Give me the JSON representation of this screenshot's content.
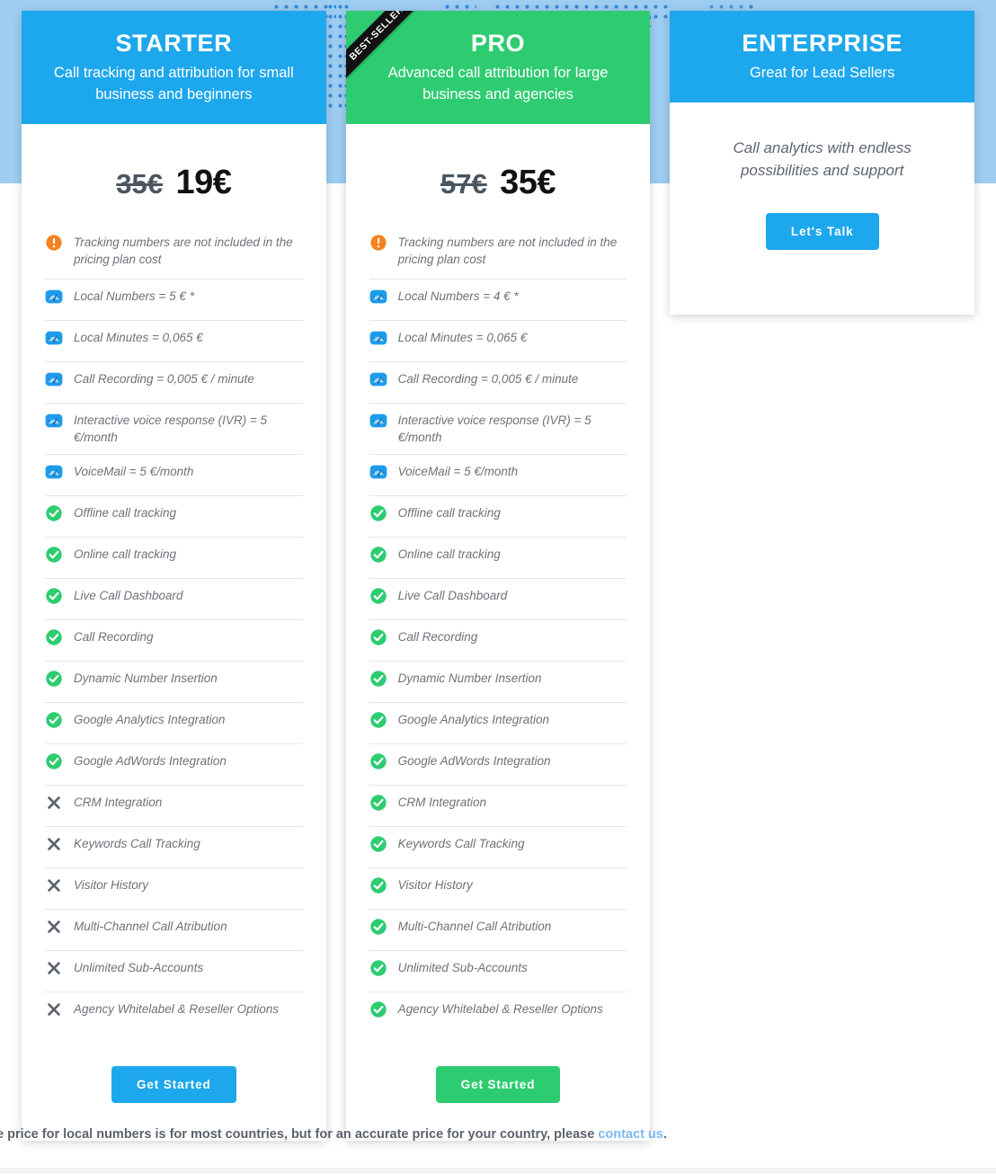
{
  "theme": {
    "blue": "#1da7ec",
    "green": "#2ecc71",
    "band_blue": "#9ecdf2",
    "orange": "#f58220",
    "cross_gray": "#5c636d",
    "link_blue": "#7db9f0"
  },
  "plans": [
    {
      "id": "starter",
      "name": "STARTER",
      "tagline": "Call tracking and attribution for small business and beginners",
      "accent": "blue",
      "badge": null,
      "price_old": "35€",
      "price_new": "19€",
      "cta": "Get Started",
      "features": [
        {
          "icon": "alert-icon",
          "text": "Tracking numbers are not included in the pricing plan cost",
          "note": true
        },
        {
          "icon": "gauge-icon",
          "text": "Local Numbers = 5 € *"
        },
        {
          "icon": "gauge-icon",
          "text": "Local Minutes = 0,065 €"
        },
        {
          "icon": "gauge-icon",
          "text": "Call Recording = 0,005 € / minute"
        },
        {
          "icon": "gauge-icon",
          "text": "Interactive voice response (IVR) = 5 €/month"
        },
        {
          "icon": "gauge-icon",
          "text": "VoiceMail = 5 €/month"
        },
        {
          "icon": "check-icon",
          "text": "Offline call tracking"
        },
        {
          "icon": "check-icon",
          "text": "Online call tracking"
        },
        {
          "icon": "check-icon",
          "text": "Live Call Dashboard"
        },
        {
          "icon": "check-icon",
          "text": "Call Recording"
        },
        {
          "icon": "check-icon",
          "text": "Dynamic Number Insertion"
        },
        {
          "icon": "check-icon",
          "text": "Google Analytics Integration"
        },
        {
          "icon": "check-icon",
          "text": "Google AdWords Integration"
        },
        {
          "icon": "cross-icon",
          "text": "CRM Integration"
        },
        {
          "icon": "cross-icon",
          "text": "Keywords Call Tracking"
        },
        {
          "icon": "cross-icon",
          "text": "Visitor History"
        },
        {
          "icon": "cross-icon",
          "text": "Multi-Channel Call Atribution"
        },
        {
          "icon": "cross-icon",
          "text": "Unlimited Sub-Accounts"
        },
        {
          "icon": "cross-icon",
          "text": "Agency Whitelabel & Reseller Options"
        }
      ]
    },
    {
      "id": "pro",
      "name": "PRO",
      "tagline": "Advanced call attribution for large business and agencies",
      "accent": "green",
      "badge": "BEST-SELLER",
      "price_old": "57€",
      "price_new": "35€",
      "cta": "Get Started",
      "features": [
        {
          "icon": "alert-icon",
          "text": "Tracking numbers are not included in the pricing plan cost",
          "note": true
        },
        {
          "icon": "gauge-icon",
          "text": "Local Numbers = 4 € *"
        },
        {
          "icon": "gauge-icon",
          "text": "Local Minutes = 0,065 €"
        },
        {
          "icon": "gauge-icon",
          "text": "Call Recording = 0,005 € / minute"
        },
        {
          "icon": "gauge-icon",
          "text": "Interactive voice response (IVR) = 5 €/month"
        },
        {
          "icon": "gauge-icon",
          "text": "VoiceMail = 5 €/month"
        },
        {
          "icon": "check-icon",
          "text": "Offline call tracking"
        },
        {
          "icon": "check-icon",
          "text": "Online call tracking"
        },
        {
          "icon": "check-icon",
          "text": "Live Call Dashboard"
        },
        {
          "icon": "check-icon",
          "text": "Call Recording"
        },
        {
          "icon": "check-icon",
          "text": "Dynamic Number Insertion"
        },
        {
          "icon": "check-icon",
          "text": "Google Analytics Integration"
        },
        {
          "icon": "check-icon",
          "text": "Google AdWords Integration"
        },
        {
          "icon": "check-icon",
          "text": "CRM Integration"
        },
        {
          "icon": "check-icon",
          "text": "Keywords Call Tracking"
        },
        {
          "icon": "check-icon",
          "text": "Visitor History"
        },
        {
          "icon": "check-icon",
          "text": "Multi-Channel Call Atribution"
        },
        {
          "icon": "check-icon",
          "text": "Unlimited Sub-Accounts"
        },
        {
          "icon": "check-icon",
          "text": "Agency Whitelabel & Reseller Options"
        }
      ]
    },
    {
      "id": "enterprise",
      "name": "ENTERPRISE",
      "tagline": "Great for Lead Sellers",
      "accent": "blue",
      "badge": null,
      "description": "Call analytics with endless possibilities and support",
      "cta": "Let's Talk"
    }
  ],
  "footnote": {
    "text_before": "e price for local numbers is for most countries, but for an accurate price for your country, please ",
    "link": "contact us",
    "text_after": "."
  }
}
